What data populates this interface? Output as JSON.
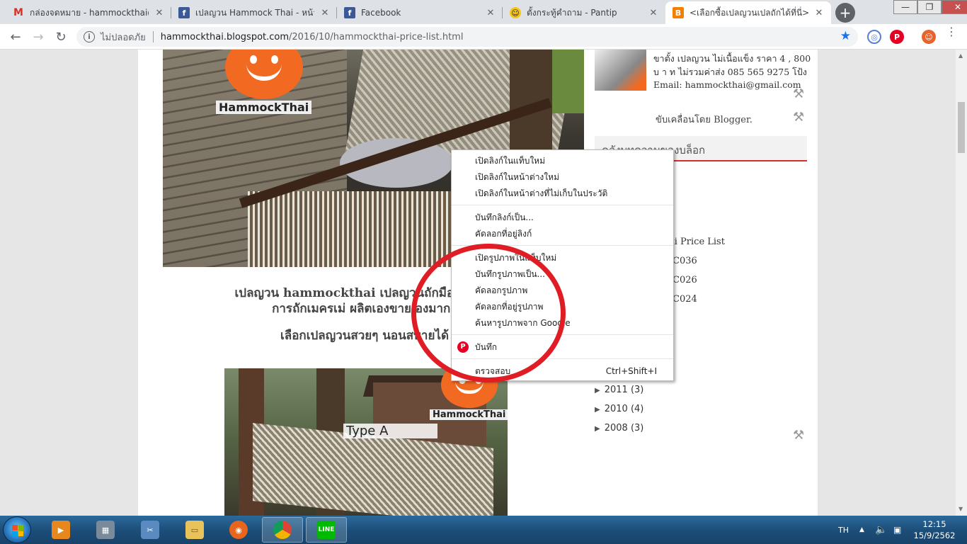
{
  "browser": {
    "tabs": [
      {
        "title": "กล่องจดหมาย - hammockthai@g",
        "icon": "gmail-icon",
        "favicon": "M"
      },
      {
        "title": "เปลญวน Hammock Thai - หน้าห",
        "icon": "facebook-icon",
        "favicon": "f"
      },
      {
        "title": "Facebook",
        "icon": "facebook-icon",
        "favicon": "f"
      },
      {
        "title": "ตั้งกระทู้คำถาม - Pantip",
        "icon": "pantip-icon",
        "favicon": "☺"
      },
      {
        "title": "<เลือกซื้อเปลญวนเปลถักได้ที่นี่> -",
        "icon": "blogger-icon",
        "favicon": "B"
      }
    ],
    "tab_close": "✕",
    "new_tab": "+",
    "window_controls": {
      "minimize": "—",
      "maximize": "❐",
      "close": "✕"
    },
    "nav": {
      "back": "←",
      "forward": "→",
      "reload": "↻"
    },
    "address": {
      "security_icon": "i",
      "security_label": "ไม่ปลอดภัย",
      "host": "hammockthai.blogspot.com",
      "path": "/2016/10/hammockthai-price-list.html"
    },
    "bookmark_star": "★",
    "extensions": [
      {
        "name": "lens-extension-icon",
        "glyph": "◎"
      },
      {
        "name": "pinterest-extension-icon",
        "glyph": "P"
      },
      {
        "name": "avatar-extension-icon",
        "glyph": "☺"
      }
    ],
    "menu": "⋮"
  },
  "page": {
    "logo_brand": "HammockThai",
    "post_line1": "เปลญวน hammockthai เปลญวนถักมือจากเชือ",
    "post_line2": "การถักเมครเม่ ผลิตเองขายเองมากา",
    "post_line3": "เลือกเปลญวนสวยๆ นอนสบายได้",
    "photo2_label": "Type A",
    "photo2_brand": "HammockThai",
    "sidebar": {
      "profile_text": "ขาตั้ง เปลญวน ไม่เนื้อแข็ง ราคา 4 , 800 บ า ท ไม่รวมค่าส่ง 085 565 9275 โป้ง Email: hammockthai@gmail.com",
      "powered_by": "ขับเคลื่อนโดย Blogger.",
      "archive_heading": "คลังบทความของบล็อก",
      "archive_items": [
        "ai Price List",
        "C036",
        "C026",
        "C024"
      ],
      "years": [
        {
          "label": "2011",
          "count": "(3)"
        },
        {
          "label": "2010",
          "count": "(4)"
        },
        {
          "label": "2008",
          "count": "(3)"
        }
      ],
      "wrench_icon": "⚒"
    }
  },
  "context_menu": {
    "items": [
      "เปิดลิงก์ในแท็บใหม่",
      "เปิดลิงก์ในหน้าต่างใหม่",
      "เปิดลิงก์ในหน้าต่างที่ไม่เก็บในประวัติ",
      "บันทึกลิงก์เป็น...",
      "คัดลอกที่อยู่ลิงก์",
      "เปิดรูปภาพในแท็บใหม่",
      "บันทึกรูปภาพเป็น...",
      "คัดลอกรูปภาพ",
      "คัดลอกที่อยู่รูปภาพ",
      "ค้นหารูปภาพจาก Google",
      "บันทึก",
      "ตรวจสอบ"
    ],
    "inspect_shortcut": "Ctrl+Shift+I",
    "pinterest_glyph": "P"
  },
  "taskbar": {
    "apps": [
      {
        "name": "media-player",
        "glyph": "▶",
        "color": "#e8871e"
      },
      {
        "name": "calculator",
        "glyph": "▦",
        "color": "#7a8a9a"
      },
      {
        "name": "snipping-tool",
        "glyph": "✂",
        "color": "#5a8ac0"
      },
      {
        "name": "file-explorer",
        "glyph": "▭",
        "color": "#e8c25a"
      },
      {
        "name": "firefox",
        "glyph": "◉",
        "color": "#e8651e"
      },
      {
        "name": "chrome",
        "glyph": "◍",
        "color": "#3d8be8"
      },
      {
        "name": "line",
        "glyph": "LINE",
        "color": "#00b900"
      }
    ],
    "language": "TH",
    "time": "12:15",
    "date": "15/9/2562"
  }
}
